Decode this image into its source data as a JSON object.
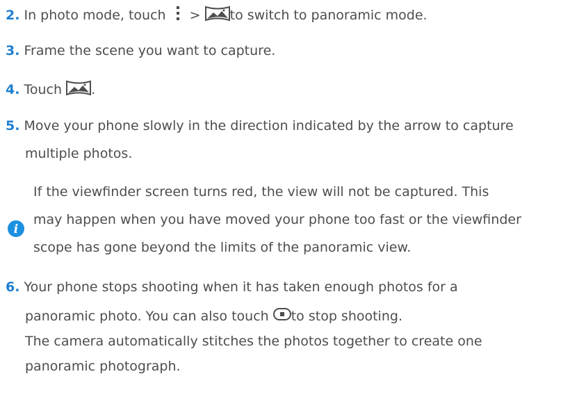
{
  "steps": {
    "s2": {
      "num": "2.",
      "text_a": " In photo mode, touch ",
      "sep": " > ",
      "text_b": "to switch to panoramic mode."
    },
    "s3": {
      "num": "3.",
      "text": " Frame the scene you want to capture."
    },
    "s4": {
      "num": "4.",
      "text": " Touch ",
      "end": "."
    },
    "s5": {
      "num": "5.",
      "line1": " Move your phone slowly in the direction indicated by the arrow to capture",
      "line2": "multiple photos."
    },
    "s6": {
      "num": "6.",
      "line1": " Your phone stops shooting when it has taken enough photos for a",
      "line2_a": "panoramic photo. You can also touch ",
      "line2_b": "to stop shooting.",
      "line3": "The camera automatically stitches the photos together to create one",
      "line4": "panoramic photograph."
    }
  },
  "note": {
    "line1": "If the viewfinder screen turns red, the view will not be captured. This",
    "line2": "may happen when you have moved your phone too fast or the viewfinder",
    "line3": "scope has gone beyond the limits of the panoramic view."
  },
  "icons": {
    "menu": "menu-dots-icon",
    "panorama": "panorama-icon",
    "stop": "stop-shooting-icon",
    "info": "info-icon"
  },
  "colors": {
    "accent": "#1f7fd0",
    "text": "#4d4d4d"
  }
}
